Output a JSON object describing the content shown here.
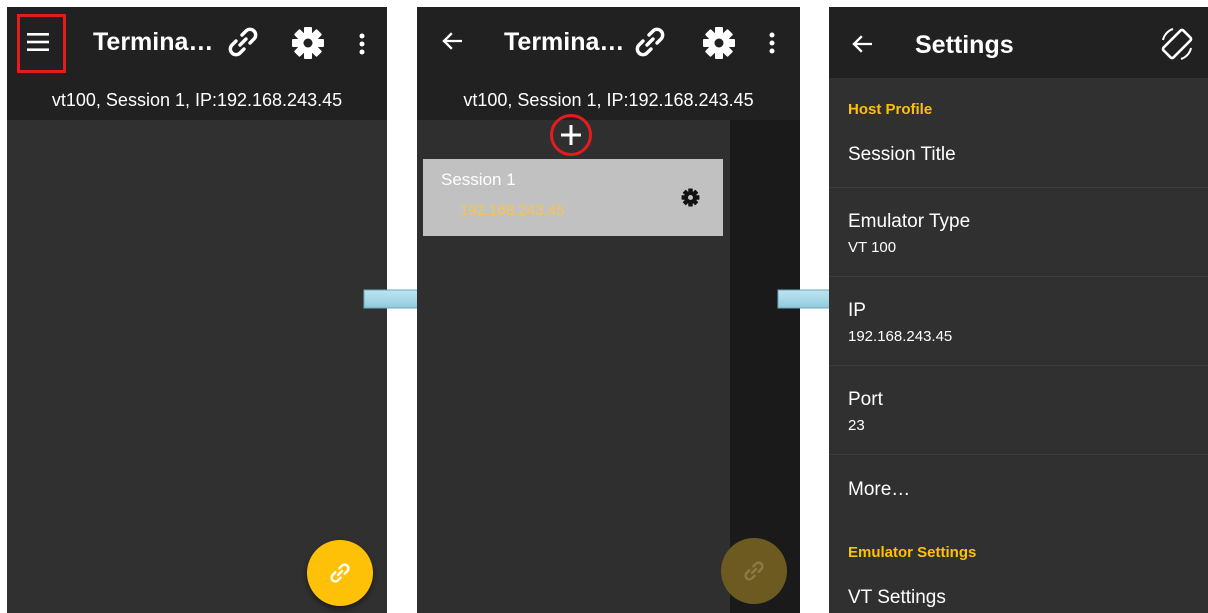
{
  "panel1": {
    "title": "Termina…",
    "status": "vt100, Session 1, IP:192.168.243.45"
  },
  "panel2": {
    "title": "Termina…",
    "status": "vt100, Session 1, IP:192.168.243.45",
    "session": {
      "title": "Session 1",
      "ip": "192.168.243.45"
    }
  },
  "panel3": {
    "title": "Settings",
    "categories": {
      "host_profile": "Host Profile",
      "emulator_settings": "Emulator Settings"
    },
    "items": [
      {
        "title": "Session Title",
        "summary": ""
      },
      {
        "title": "Emulator Type",
        "summary": "VT 100"
      },
      {
        "title": "IP",
        "summary": "192.168.243.45"
      },
      {
        "title": "Port",
        "summary": "23"
      },
      {
        "title": "More…",
        "summary": ""
      },
      {
        "title": "VT Settings",
        "summary": ""
      }
    ]
  },
  "colors": {
    "accent": "#ffc107",
    "highlight": "#e51c1c",
    "toolbar": "#212121",
    "background": "#303030",
    "arrow": "#a8d8e8"
  },
  "icons": [
    "menu-icon",
    "link-icon",
    "gear-icon",
    "more-vert-icon",
    "back-arrow-icon",
    "add-icon",
    "screen-rotation-icon",
    "right-arrow-icon"
  ]
}
